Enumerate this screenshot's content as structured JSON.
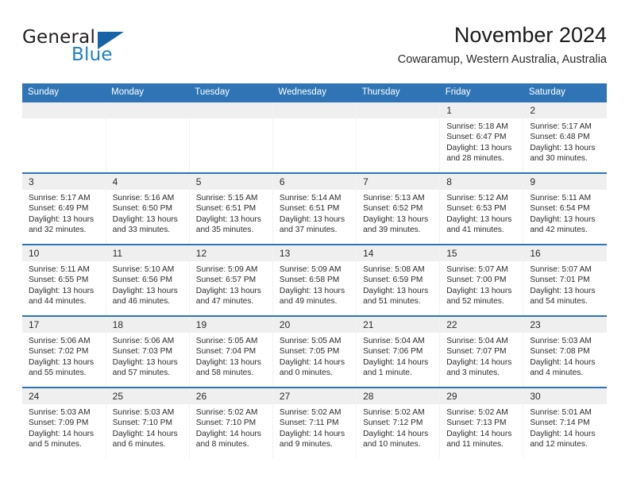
{
  "brand": {
    "word_general": "General",
    "word_blue": "Blue",
    "triangle_color": "#1663a8",
    "blue_color": "#1e7fc4"
  },
  "header": {
    "month_title": "November 2024",
    "location": "Cowaramup, Western Australia, Australia"
  },
  "theme": {
    "header_blue": "#2f75b5",
    "daynum_band": "#efefef",
    "text": "#2b2b2b"
  },
  "weekday_headers": [
    "Sunday",
    "Monday",
    "Tuesday",
    "Wednesday",
    "Thursday",
    "Friday",
    "Saturday"
  ],
  "weeks": [
    [
      {
        "day": "",
        "sunrise": "",
        "sunset": "",
        "daylight1": "",
        "daylight2": ""
      },
      {
        "day": "",
        "sunrise": "",
        "sunset": "",
        "daylight1": "",
        "daylight2": ""
      },
      {
        "day": "",
        "sunrise": "",
        "sunset": "",
        "daylight1": "",
        "daylight2": ""
      },
      {
        "day": "",
        "sunrise": "",
        "sunset": "",
        "daylight1": "",
        "daylight2": ""
      },
      {
        "day": "",
        "sunrise": "",
        "sunset": "",
        "daylight1": "",
        "daylight2": ""
      },
      {
        "day": "1",
        "sunrise": "Sunrise: 5:18 AM",
        "sunset": "Sunset: 6:47 PM",
        "daylight1": "Daylight: 13 hours",
        "daylight2": "and 28 minutes."
      },
      {
        "day": "2",
        "sunrise": "Sunrise: 5:17 AM",
        "sunset": "Sunset: 6:48 PM",
        "daylight1": "Daylight: 13 hours",
        "daylight2": "and 30 minutes."
      }
    ],
    [
      {
        "day": "3",
        "sunrise": "Sunrise: 5:17 AM",
        "sunset": "Sunset: 6:49 PM",
        "daylight1": "Daylight: 13 hours",
        "daylight2": "and 32 minutes."
      },
      {
        "day": "4",
        "sunrise": "Sunrise: 5:16 AM",
        "sunset": "Sunset: 6:50 PM",
        "daylight1": "Daylight: 13 hours",
        "daylight2": "and 33 minutes."
      },
      {
        "day": "5",
        "sunrise": "Sunrise: 5:15 AM",
        "sunset": "Sunset: 6:51 PM",
        "daylight1": "Daylight: 13 hours",
        "daylight2": "and 35 minutes."
      },
      {
        "day": "6",
        "sunrise": "Sunrise: 5:14 AM",
        "sunset": "Sunset: 6:51 PM",
        "daylight1": "Daylight: 13 hours",
        "daylight2": "and 37 minutes."
      },
      {
        "day": "7",
        "sunrise": "Sunrise: 5:13 AM",
        "sunset": "Sunset: 6:52 PM",
        "daylight1": "Daylight: 13 hours",
        "daylight2": "and 39 minutes."
      },
      {
        "day": "8",
        "sunrise": "Sunrise: 5:12 AM",
        "sunset": "Sunset: 6:53 PM",
        "daylight1": "Daylight: 13 hours",
        "daylight2": "and 41 minutes."
      },
      {
        "day": "9",
        "sunrise": "Sunrise: 5:11 AM",
        "sunset": "Sunset: 6:54 PM",
        "daylight1": "Daylight: 13 hours",
        "daylight2": "and 42 minutes."
      }
    ],
    [
      {
        "day": "10",
        "sunrise": "Sunrise: 5:11 AM",
        "sunset": "Sunset: 6:55 PM",
        "daylight1": "Daylight: 13 hours",
        "daylight2": "and 44 minutes."
      },
      {
        "day": "11",
        "sunrise": "Sunrise: 5:10 AM",
        "sunset": "Sunset: 6:56 PM",
        "daylight1": "Daylight: 13 hours",
        "daylight2": "and 46 minutes."
      },
      {
        "day": "12",
        "sunrise": "Sunrise: 5:09 AM",
        "sunset": "Sunset: 6:57 PM",
        "daylight1": "Daylight: 13 hours",
        "daylight2": "and 47 minutes."
      },
      {
        "day": "13",
        "sunrise": "Sunrise: 5:09 AM",
        "sunset": "Sunset: 6:58 PM",
        "daylight1": "Daylight: 13 hours",
        "daylight2": "and 49 minutes."
      },
      {
        "day": "14",
        "sunrise": "Sunrise: 5:08 AM",
        "sunset": "Sunset: 6:59 PM",
        "daylight1": "Daylight: 13 hours",
        "daylight2": "and 51 minutes."
      },
      {
        "day": "15",
        "sunrise": "Sunrise: 5:07 AM",
        "sunset": "Sunset: 7:00 PM",
        "daylight1": "Daylight: 13 hours",
        "daylight2": "and 52 minutes."
      },
      {
        "day": "16",
        "sunrise": "Sunrise: 5:07 AM",
        "sunset": "Sunset: 7:01 PM",
        "daylight1": "Daylight: 13 hours",
        "daylight2": "and 54 minutes."
      }
    ],
    [
      {
        "day": "17",
        "sunrise": "Sunrise: 5:06 AM",
        "sunset": "Sunset: 7:02 PM",
        "daylight1": "Daylight: 13 hours",
        "daylight2": "and 55 minutes."
      },
      {
        "day": "18",
        "sunrise": "Sunrise: 5:06 AM",
        "sunset": "Sunset: 7:03 PM",
        "daylight1": "Daylight: 13 hours",
        "daylight2": "and 57 minutes."
      },
      {
        "day": "19",
        "sunrise": "Sunrise: 5:05 AM",
        "sunset": "Sunset: 7:04 PM",
        "daylight1": "Daylight: 13 hours",
        "daylight2": "and 58 minutes."
      },
      {
        "day": "20",
        "sunrise": "Sunrise: 5:05 AM",
        "sunset": "Sunset: 7:05 PM",
        "daylight1": "Daylight: 14 hours",
        "daylight2": "and 0 minutes."
      },
      {
        "day": "21",
        "sunrise": "Sunrise: 5:04 AM",
        "sunset": "Sunset: 7:06 PM",
        "daylight1": "Daylight: 14 hours",
        "daylight2": "and 1 minute."
      },
      {
        "day": "22",
        "sunrise": "Sunrise: 5:04 AM",
        "sunset": "Sunset: 7:07 PM",
        "daylight1": "Daylight: 14 hours",
        "daylight2": "and 3 minutes."
      },
      {
        "day": "23",
        "sunrise": "Sunrise: 5:03 AM",
        "sunset": "Sunset: 7:08 PM",
        "daylight1": "Daylight: 14 hours",
        "daylight2": "and 4 minutes."
      }
    ],
    [
      {
        "day": "24",
        "sunrise": "Sunrise: 5:03 AM",
        "sunset": "Sunset: 7:09 PM",
        "daylight1": "Daylight: 14 hours",
        "daylight2": "and 5 minutes."
      },
      {
        "day": "25",
        "sunrise": "Sunrise: 5:03 AM",
        "sunset": "Sunset: 7:10 PM",
        "daylight1": "Daylight: 14 hours",
        "daylight2": "and 6 minutes."
      },
      {
        "day": "26",
        "sunrise": "Sunrise: 5:02 AM",
        "sunset": "Sunset: 7:10 PM",
        "daylight1": "Daylight: 14 hours",
        "daylight2": "and 8 minutes."
      },
      {
        "day": "27",
        "sunrise": "Sunrise: 5:02 AM",
        "sunset": "Sunset: 7:11 PM",
        "daylight1": "Daylight: 14 hours",
        "daylight2": "and 9 minutes."
      },
      {
        "day": "28",
        "sunrise": "Sunrise: 5:02 AM",
        "sunset": "Sunset: 7:12 PM",
        "daylight1": "Daylight: 14 hours",
        "daylight2": "and 10 minutes."
      },
      {
        "day": "29",
        "sunrise": "Sunrise: 5:02 AM",
        "sunset": "Sunset: 7:13 PM",
        "daylight1": "Daylight: 14 hours",
        "daylight2": "and 11 minutes."
      },
      {
        "day": "30",
        "sunrise": "Sunrise: 5:01 AM",
        "sunset": "Sunset: 7:14 PM",
        "daylight1": "Daylight: 14 hours",
        "daylight2": "and 12 minutes."
      }
    ]
  ]
}
